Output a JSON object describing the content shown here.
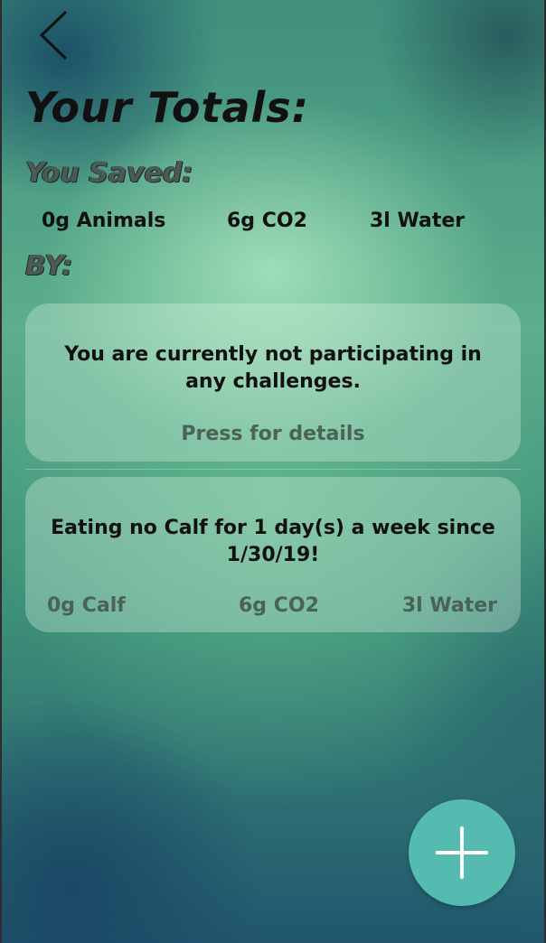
{
  "header": {
    "back_icon": "chevron-left-icon"
  },
  "totals": {
    "title": "Your Totals:",
    "saved_label": "You Saved:",
    "items": [
      {
        "value": "0g Animals"
      },
      {
        "value": "6g CO2"
      },
      {
        "value": "3l Water"
      }
    ],
    "by_label": "BY:"
  },
  "challenge_card": {
    "message": "You are currently not participating in any challenges.",
    "details_label": "Press for details"
  },
  "habit_card": {
    "message": "Eating no Calf for 1 day(s) a week since 1/30/19!",
    "stats": [
      {
        "value": "0g Calf"
      },
      {
        "value": "6g CO2"
      },
      {
        "value": "3l Water"
      }
    ]
  },
  "fab": {
    "icon": "plus-icon",
    "color": "#55bbb1"
  }
}
